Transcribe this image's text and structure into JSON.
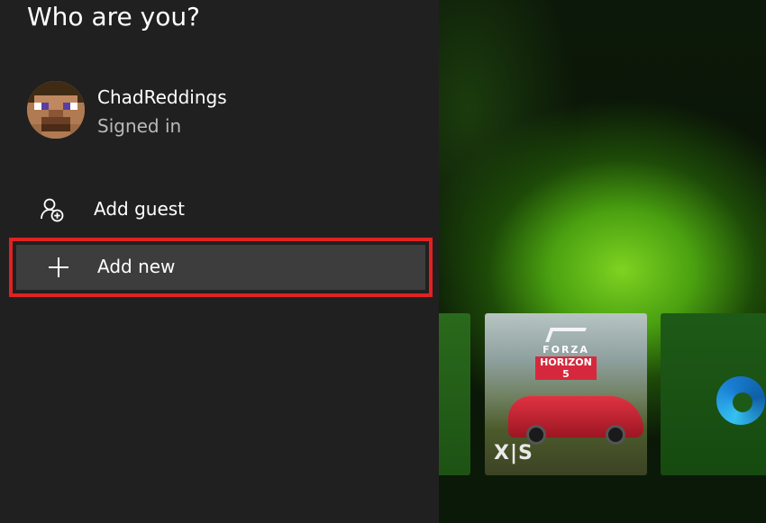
{
  "panel": {
    "title": "Who are you?"
  },
  "profile": {
    "name": "ChadReddings",
    "status": "Signed in",
    "avatar_icon": "minecraft-steve-avatar"
  },
  "menu": {
    "items": [
      {
        "label": "Add guest",
        "icon": "add-guest-icon"
      },
      {
        "label": "Add new",
        "icon": "plus-icon",
        "highlighted": true
      }
    ]
  },
  "tiles": [
    {
      "name": "partial-green-tile"
    },
    {
      "name": "forza-horizon-5-tile",
      "logo_top": "FORZA",
      "logo_bottom": "HORIZON 5",
      "badge": "X|S"
    },
    {
      "name": "edge-tile",
      "icon": "edge-icon"
    }
  ],
  "colors": {
    "panel_bg": "#202020",
    "highlight_border": "#e02222",
    "highlight_bg": "#3d3d3d",
    "xbox_green": "#7ed321"
  }
}
